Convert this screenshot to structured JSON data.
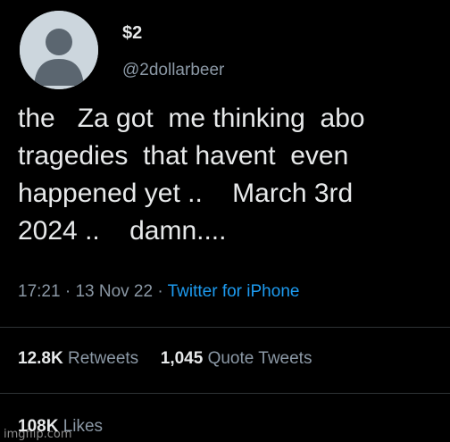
{
  "user": {
    "display_name": "$2",
    "handle": "@2dollarbeer",
    "avatar_icon": "default-profile-silhouette-icon"
  },
  "tweet": {
    "lines": [
      "the   Za got  me thinking  abo",
      "tragedies  that havent  even",
      "happened yet ..    March 3rd",
      "2024 ..    damn...."
    ]
  },
  "meta": {
    "time": "17:21",
    "date": "13 Nov 22",
    "separator": " · ",
    "source": "Twitter for iPhone"
  },
  "stats": {
    "retweets_count": "12.8K",
    "retweets_label": "Retweets",
    "quotes_count": "1,045",
    "quotes_label": "Quote Tweets",
    "likes_count": "108K",
    "likes_label": "Likes"
  },
  "watermark": "imgflip.com",
  "colors": {
    "background": "#000000",
    "text": "#e7e9ea",
    "secondary": "#8b98a5",
    "link": "#1d9bf0",
    "divider": "#2f3336"
  }
}
